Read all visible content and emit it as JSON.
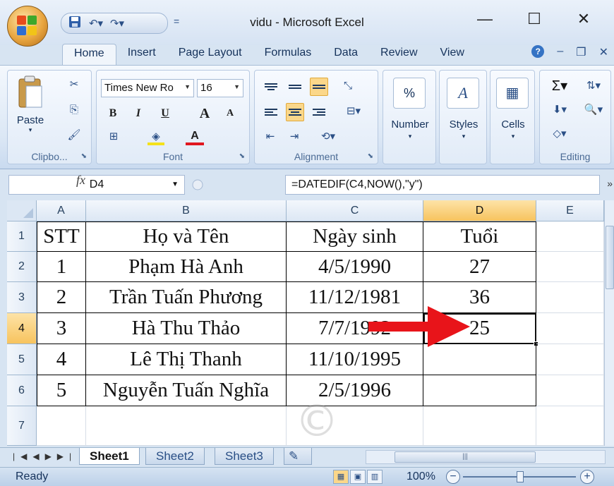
{
  "window": {
    "title": "vidu - Microsoft Excel",
    "minimize": "—",
    "maximize": "☐",
    "close": "✕"
  },
  "quick_access": {
    "save_icon": "save-icon",
    "undo_icon": "undo-icon",
    "redo_icon": "redo-icon",
    "more": "="
  },
  "tabs": [
    "Home",
    "Insert",
    "Page Layout",
    "Formulas",
    "Data",
    "Review",
    "View"
  ],
  "active_tab": "Home",
  "ribbon": {
    "clipboard": {
      "paste_label": "Paste",
      "group_label": "Clipbo..."
    },
    "font": {
      "font_name": "Times New Ro",
      "font_size": "16",
      "bold": "B",
      "italic": "I",
      "underline": "U",
      "grow": "A",
      "shrink": "A",
      "color_a": "A",
      "group_label": "Font"
    },
    "alignment": {
      "group_label": "Alignment"
    },
    "number": {
      "symbol": "%",
      "label": "Number"
    },
    "styles": {
      "label": "Styles"
    },
    "cells": {
      "label": "Cells"
    },
    "editing": {
      "sigma": "Σ",
      "group_label": "Editing"
    }
  },
  "formula_bar": {
    "name_box": "D4",
    "fx": "fx",
    "formula": "=DATEDIF(C4,NOW(),\"y\")"
  },
  "grid": {
    "columns": [
      "A",
      "B",
      "C",
      "D",
      "E"
    ],
    "selected_column": "D",
    "rows": [
      "1",
      "2",
      "3",
      "4",
      "5",
      "6",
      "7"
    ],
    "selected_row": "4",
    "header": [
      "STT",
      "Họ và Tên",
      "Ngày sinh",
      "Tuổi"
    ],
    "data": [
      [
        "1",
        "Phạm Hà Anh",
        "4/5/1990",
        "27"
      ],
      [
        "2",
        "Trần Tuấn Phương",
        "11/12/1981",
        "36"
      ],
      [
        "3",
        "Hà Thu Thảo",
        "7/7/1992",
        "25"
      ],
      [
        "4",
        "Lê Thị Thanh",
        "11/10/1995",
        ""
      ],
      [
        "5",
        "Nguyễn Tuấn Nghĩa",
        "2/5/1996",
        ""
      ]
    ]
  },
  "sheets": [
    "Sheet1",
    "Sheet2",
    "Sheet3"
  ],
  "active_sheet": "Sheet1",
  "status": {
    "text": "Ready",
    "zoom": "100%",
    "zoom_minus": "−",
    "zoom_plus": "+"
  },
  "colors": {
    "selected_header": "#f7c35e",
    "annotation_arrow": "#e8141a"
  }
}
